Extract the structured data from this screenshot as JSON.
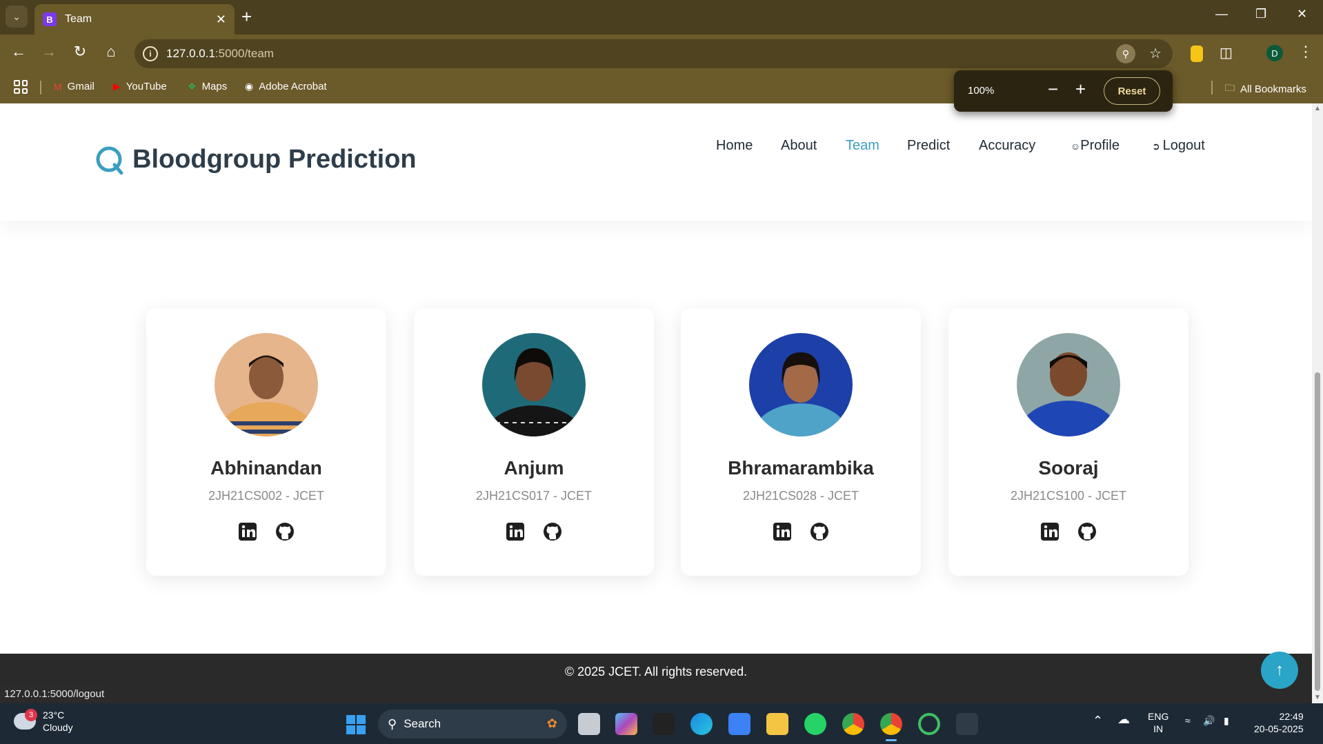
{
  "browser": {
    "tab_title": "Team",
    "tab_favicon_letter": "B",
    "url_host": "127.0.0.1",
    "url_path": ":5000/team",
    "zoom_popup": {
      "value": "100%",
      "reset_label": "Reset"
    },
    "bookmarks": [
      {
        "label": "Gmail",
        "icon": "gmail-icon"
      },
      {
        "label": "YouTube",
        "icon": "youtube-icon"
      },
      {
        "label": "Maps",
        "icon": "maps-icon"
      },
      {
        "label": "Adobe Acrobat",
        "icon": "globe-icon"
      }
    ],
    "all_bookmarks_label": "All Bookmarks",
    "profile_initial": "D",
    "status_url": "127.0.0.1:5000/logout"
  },
  "site": {
    "brand": "Bloodgroup Prediction",
    "nav": {
      "home": "Home",
      "about": "About",
      "team": "Team",
      "predict": "Predict",
      "accuracy": "Accuracy",
      "profile": "Profile",
      "logout": "Logout"
    },
    "accent_color": "#3b9ec0",
    "members": [
      {
        "name": "Abhinandan",
        "id": "2JH21CS002 - JCET"
      },
      {
        "name": "Anjum",
        "id": "2JH21CS017 - JCET"
      },
      {
        "name": "Bhramarambika",
        "id": "2JH21CS028 - JCET"
      },
      {
        "name": "Sooraj",
        "id": "2JH21CS100 - JCET"
      }
    ],
    "footer": "© 2025 JCET. All rights reserved."
  },
  "taskbar": {
    "weather_temp": "23°C",
    "weather_desc": "Cloudy",
    "weather_badge": "3",
    "search_label": "Search",
    "lang_line1": "ENG",
    "lang_line2": "IN",
    "time": "22:49",
    "date": "20-05-2025"
  }
}
